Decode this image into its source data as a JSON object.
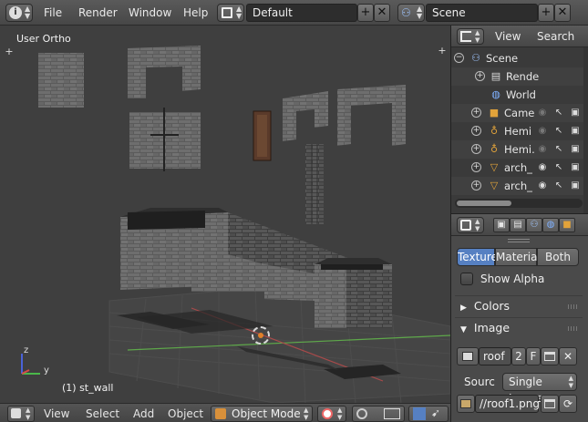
{
  "topbar": {
    "menus": [
      "File",
      "Render",
      "Window",
      "Help"
    ],
    "screen_layout": "Default",
    "scene": "Scene",
    "add_symbol": "+",
    "close_symbol": "✕"
  },
  "viewport": {
    "view_label": "User Ortho",
    "status": "(1) st_wall",
    "axis_z": "z",
    "axis_y": "y",
    "plus_symbol": "+",
    "bottom": {
      "menus": [
        "View",
        "Select",
        "Add",
        "Object"
      ],
      "mode": "Object Mode"
    }
  },
  "outliner": {
    "header": {
      "view": "View",
      "search": "Search"
    },
    "rows": [
      {
        "name": "Scene",
        "icon": "scene-icon",
        "expander": "−"
      },
      {
        "name": "Rende",
        "icon": "render-layers-icon",
        "expander": "+"
      },
      {
        "name": "World",
        "icon": "world-icon",
        "expander": ""
      },
      {
        "name": "Came",
        "icon": "camera-icon",
        "expander": "+"
      },
      {
        "name": "Hemi",
        "icon": "lamp-icon",
        "expander": "+"
      },
      {
        "name": "Hemi.",
        "icon": "lamp-icon",
        "expander": "+"
      },
      {
        "name": "arch_",
        "icon": "mesh-icon",
        "expander": "+"
      },
      {
        "name": "arch_",
        "icon": "mesh-icon",
        "expander": "+"
      }
    ]
  },
  "properties": {
    "tabs": [
      "Texture",
      "Material",
      "Both"
    ],
    "active_tab": "Texture",
    "show_alpha": "Show Alpha",
    "panels": {
      "colors": "Colors",
      "image": "Image"
    },
    "image": {
      "name": "roof",
      "users": "2",
      "fake_user": "F",
      "source_label": "Sourc",
      "source_value": "Single Image",
      "path": "//roof1.png"
    }
  },
  "colors": {
    "active_tab": "#5680c2",
    "background": "#3f3f3f",
    "grid": "#4a4a4a",
    "x_axis": "#8a3a3a",
    "y_axis": "#4a8a3a"
  }
}
